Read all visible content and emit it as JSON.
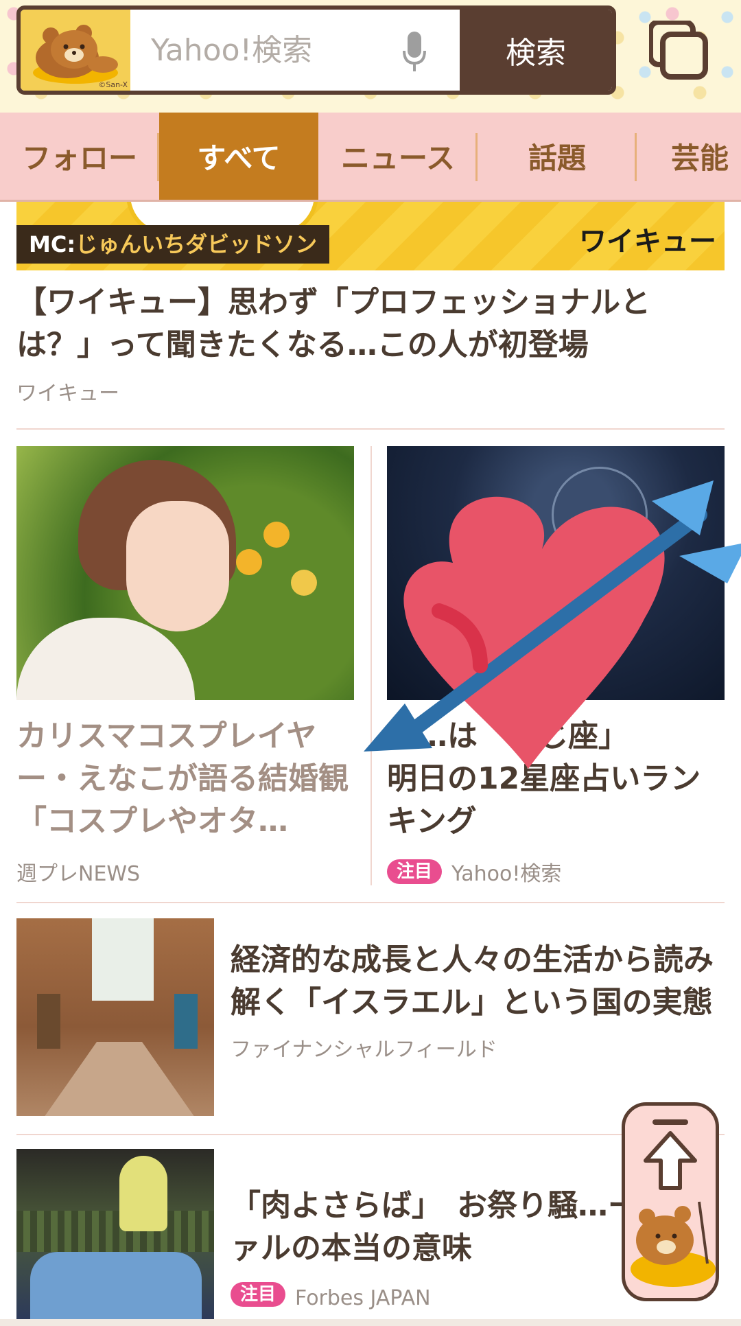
{
  "header": {
    "search_placeholder": "Yahoo!検索",
    "search_button": "検索",
    "mascot_credit": "©San-X"
  },
  "nav": {
    "tabs": [
      {
        "label": "フォロー"
      },
      {
        "label": "すべて",
        "active": true
      },
      {
        "label": "ニュース"
      },
      {
        "label": "話題"
      },
      {
        "label": "芸能"
      }
    ]
  },
  "banner": {
    "mc_prefix": "MC:",
    "mc_name": "じゅんいちダビッドソン",
    "logo": "ワイキュー"
  },
  "articles": {
    "top": {
      "title": "【ワイキュー】思わず「プロフェッショナルとは？」って聞きたくなる…この人が初登場",
      "source": "ワイキュー"
    },
    "grid_left": {
      "title": "カリスマコスプレイヤー・えなこが語る結婚観「コスプレやオタ…",
      "source": "週プレNEWS"
    },
    "grid_right": {
      "title_line1": "「…は　…じ座」",
      "title_line2": "明日の12星座占いランキング",
      "badge": "注目",
      "source": "Yahoo!検索"
    },
    "list_1": {
      "title": "経済的な成長と人々の生活から読み解く「イスラエル」という国の実態",
      "source": "ファイナンシャルフィールド"
    },
    "list_2": {
      "title": "「肉よさらば」　お祭り騒…ーニヴァルの本当の意味",
      "badge": "注目",
      "source": "Forbes JAPAN"
    }
  },
  "colors": {
    "header_brown": "#5a3e31",
    "nav_bg": "#f8cdcb",
    "nav_active": "#c47c1f",
    "badge_pink": "#e94d8f"
  },
  "icons": {
    "mic": "mic-icon",
    "tabs": "tabs-icon",
    "scroll_top": "arrow-up-icon",
    "sticker": "heart-with-arrow-icon"
  }
}
